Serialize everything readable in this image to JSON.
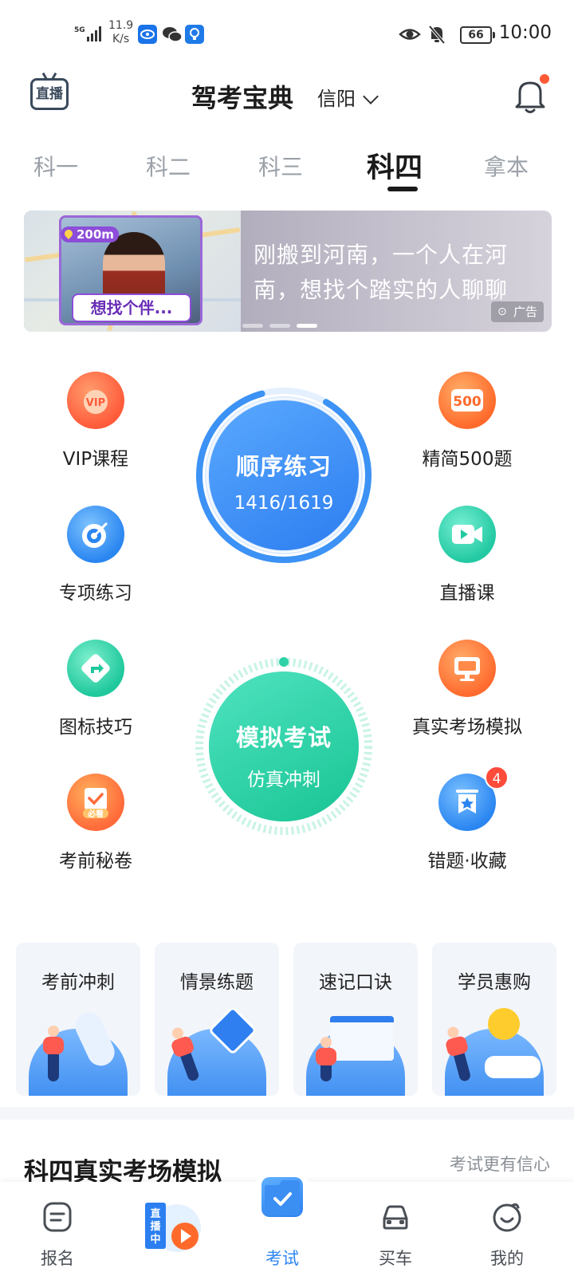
{
  "status_bar": {
    "network": "5G",
    "speed_value": "11.9",
    "speed_unit": "K/s",
    "battery": "66",
    "time": "10:00"
  },
  "header": {
    "live_label": "直播",
    "title": "驾考宝典",
    "city": "信阳"
  },
  "tabs": [
    {
      "label": "科一"
    },
    {
      "label": "科二"
    },
    {
      "label": "科三"
    },
    {
      "label": "科四",
      "active": true
    },
    {
      "label": "拿本"
    }
  ],
  "banner": {
    "distance": "200m",
    "cta": "想找个伴...",
    "text_line1": "刚搬到河南，一个人在河",
    "text_line2": "南，想找个踏实的人聊聊",
    "ad_label": "广告",
    "slides": 3,
    "active_slide": 3
  },
  "features_left": [
    {
      "label": "VIP课程",
      "icon": "vip-medal-icon",
      "icon_text": "VIP"
    },
    {
      "label": "专项练习",
      "icon": "target-icon"
    },
    {
      "label": "图标技巧",
      "icon": "road-sign-icon"
    },
    {
      "label": "考前秘卷",
      "icon": "secret-paper-icon",
      "icon_text": "必看"
    }
  ],
  "features_right": [
    {
      "label": "精简500题",
      "icon": "500-badge-icon",
      "icon_text": "500"
    },
    {
      "label": "直播课",
      "icon": "video-camera-icon"
    },
    {
      "label": "真实考场模拟",
      "icon": "monitor-icon"
    },
    {
      "label": "错题·收藏",
      "icon": "star-bookmark-icon",
      "badge": "4"
    }
  ],
  "practice": {
    "title": "顺序练习",
    "progress_text": "1416/1619",
    "done": 1416,
    "total": 1619
  },
  "exam": {
    "title": "模拟考试",
    "subtitle": "仿真冲刺"
  },
  "cards": [
    {
      "label": "考前冲刺"
    },
    {
      "label": "情景练题"
    },
    {
      "label": "速记口诀"
    },
    {
      "label": "学员惠购"
    }
  ],
  "section": {
    "title": "科四真实考场模拟",
    "subtitle": "考试更有信心"
  },
  "bottom_nav": [
    {
      "label": "报名",
      "icon": "signup-icon"
    },
    {
      "label": "",
      "icon": "live-now-icon",
      "live_text": "直播中"
    },
    {
      "label": "考试",
      "icon": "exam-check-icon",
      "active": true
    },
    {
      "label": "买车",
      "icon": "car-icon"
    },
    {
      "label": "我的",
      "icon": "profile-smile-icon"
    }
  ],
  "colors": {
    "accent_blue": "#2c86f3",
    "accent_green": "#1fc89c",
    "notify_red": "#ff5a36"
  }
}
